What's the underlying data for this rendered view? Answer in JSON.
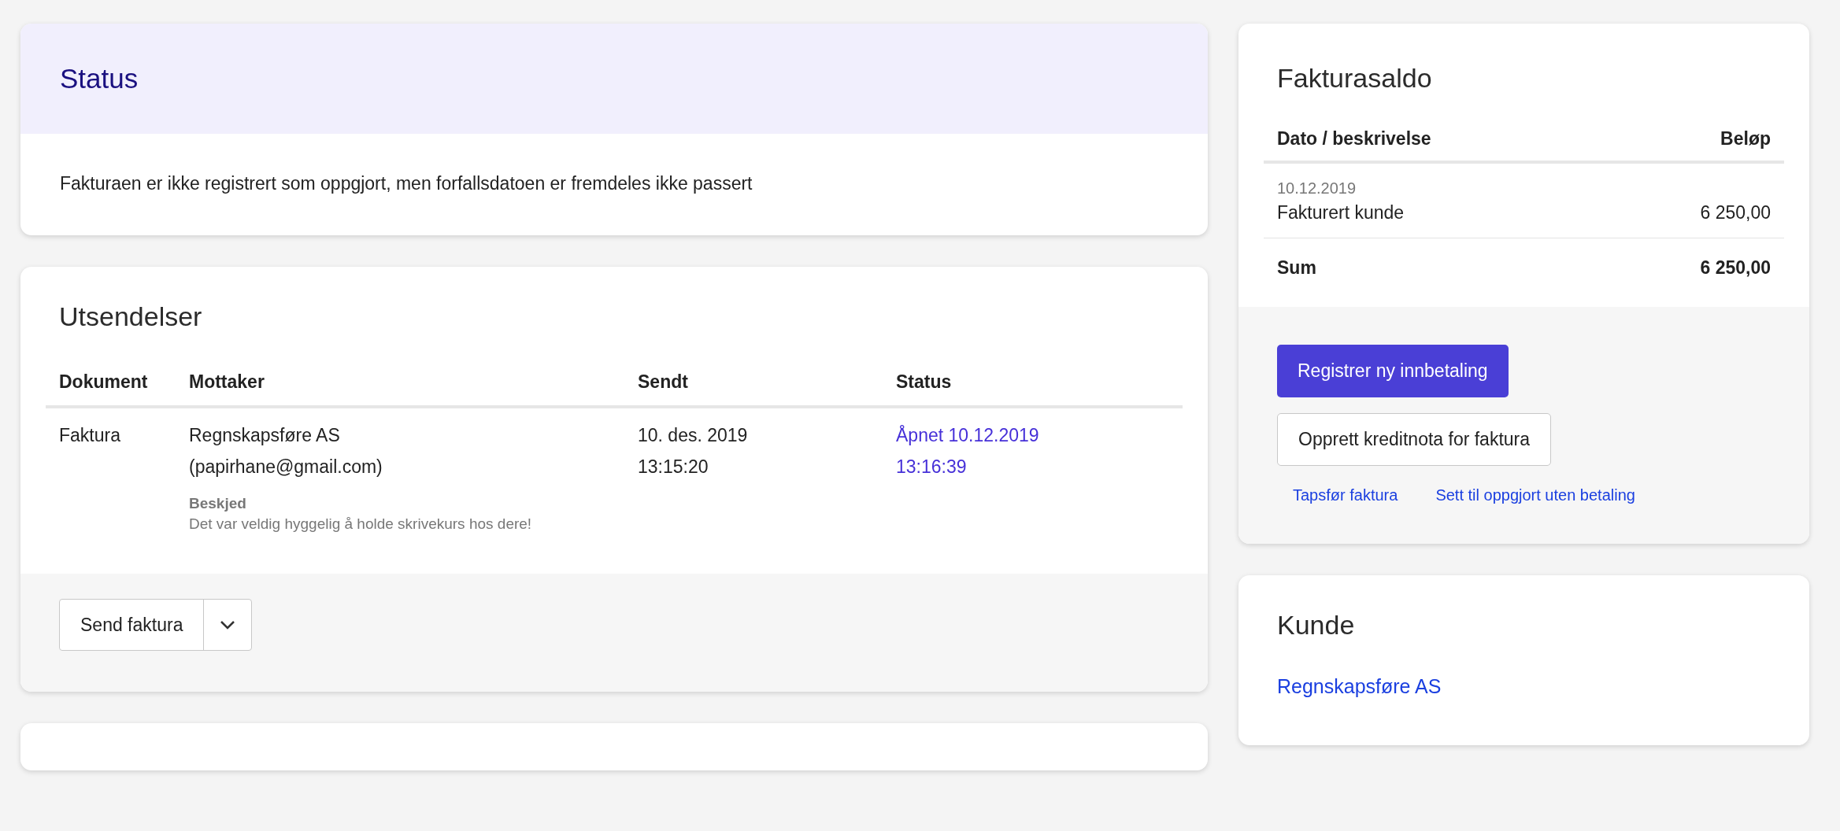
{
  "status_card": {
    "title": "Status",
    "message": "Fakturaen er ikke registrert som oppgjort, men forfallsdatoen er fremdeles ikke passert"
  },
  "dispatches": {
    "title": "Utsendelser",
    "columns": [
      "Dokument",
      "Mottaker",
      "Sendt",
      "Status"
    ],
    "rows": [
      {
        "document": "Faktura",
        "recipient_name": "Regnskapsføre AS",
        "recipient_email": "(papirhane@gmail.com)",
        "message_label": "Beskjed",
        "message": "Det var veldig hyggelig å holde skrivekurs hos dere!",
        "sent_date": "10. des. 2019",
        "sent_time": "13:15:20",
        "status_line_1": "Åpnet 10.12.2019",
        "status_line_2": "13:16:39"
      }
    ],
    "send_button": "Send faktura"
  },
  "balance": {
    "title": "Fakturasaldo",
    "columns": [
      "Dato / beskrivelse",
      "Beløp"
    ],
    "rows": [
      {
        "date": "10.12.2019",
        "description": "Fakturert kunde",
        "amount": "6 250,00"
      }
    ],
    "sum_label": "Sum",
    "sum_amount": "6 250,00",
    "primary_button": "Registrer ny innbetaling",
    "secondary_button": "Opprett kreditnota for faktura",
    "links": [
      "Tapsfør faktura",
      "Sett til oppgjort uten betaling"
    ]
  },
  "customer": {
    "title": "Kunde",
    "name_link": "Regnskapsføre AS"
  }
}
